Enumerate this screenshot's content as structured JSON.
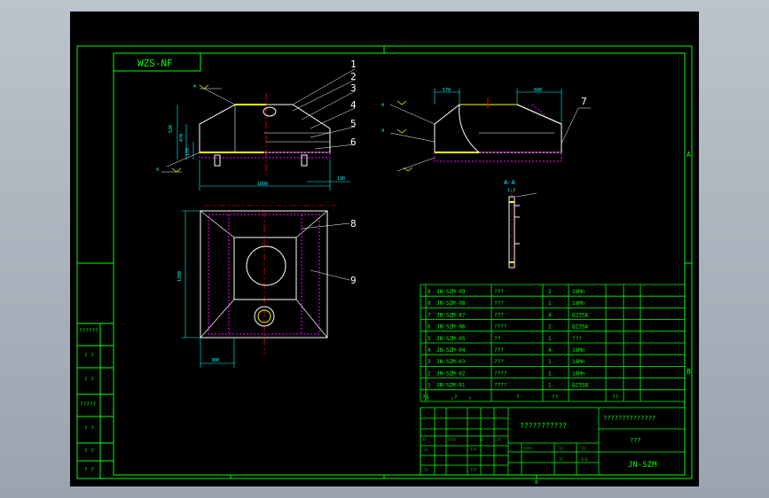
{
  "title_tag": "WZS-NF",
  "drawing_no": "JN-SZM",
  "title_block": {
    "main_title": "???????????",
    "company": "??????????????",
    "subtitle": "???",
    "sign_row_a": [
      "??",
      "?",
      "?"
    ],
    "sign_row_b": [
      "??",
      "????",
      "??",
      "??"
    ],
    "sign_row_c": [
      "??",
      "???"
    ],
    "sign_row_d": [
      "????",
      "??",
      "??"
    ],
    "sign_row_e": [
      "??",
      "1:5"
    ],
    "sign_row_f": [
      "??",
      "???"
    ]
  },
  "bom_header": [
    "??",
    "?",
    "?",
    "??",
    "??"
  ],
  "bom": [
    {
      "no": "9",
      "code": "JN-SZM-09",
      "name": "???",
      "qty": "2",
      "material": "16Mn"
    },
    {
      "no": "8",
      "code": "JN-SZM-08",
      "name": "???",
      "qty": "1",
      "material": "16Mn"
    },
    {
      "no": "7",
      "code": "JN-SZM-07",
      "name": "???",
      "qty": "4",
      "material": "Q235A"
    },
    {
      "no": "6",
      "code": "JN-SZM-06",
      "name": "????",
      "qty": "2",
      "material": "Q235A"
    },
    {
      "no": "5",
      "code": "JN-SZM-05",
      "name": "??",
      "qty": "1",
      "material": "???"
    },
    {
      "no": "4",
      "code": "JN-SZM-04",
      "name": "???",
      "qty": "4",
      "material": "16Mn"
    },
    {
      "no": "3",
      "code": "JN-SZM-03",
      "name": "???",
      "qty": "1",
      "material": "16Mn"
    },
    {
      "no": "2",
      "code": "JN-SZM-02",
      "name": "????",
      "qty": "1",
      "material": "16Mn"
    },
    {
      "no": "1",
      "code": "JN-SZM-01",
      "name": "????",
      "qty": "1",
      "material": "Q235B"
    }
  ],
  "left_strip": [
    "??????",
    "? ?",
    "? ?",
    "?????",
    "? ?",
    "? ?",
    "? ?"
  ],
  "callouts": [
    "1",
    "2",
    "3",
    "4",
    "5",
    "6",
    "7",
    "8",
    "9"
  ],
  "section_label": "A-A",
  "section_scale": "1:3",
  "zone_letters": [
    "A",
    "B"
  ],
  "dimensions": {
    "front_width": "1890",
    "front_height": "520",
    "front_height2": "470",
    "front_height3": "175",
    "front_right": "190",
    "plan_height": "1380",
    "plan_bottom": "380",
    "side_top_left": "570",
    "side_top_right": "690"
  },
  "weld_symbols": [
    "4",
    "4",
    "4",
    "4"
  ],
  "colors": {
    "background": "#000000",
    "frame": "#00ff00",
    "geometry": "#ffffff",
    "dimension": "#00ffff",
    "hidden": "#ff00ff",
    "centerline": "#ff0000",
    "weld": "#ffff00"
  }
}
